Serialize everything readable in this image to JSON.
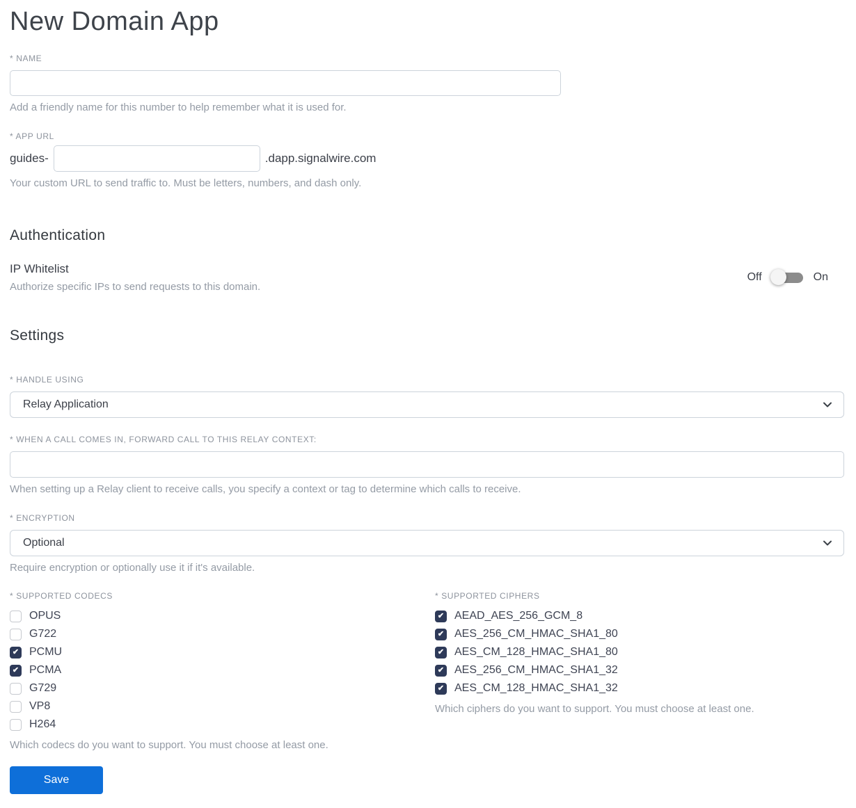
{
  "page": {
    "title": "New Domain App"
  },
  "fields": {
    "name": {
      "label": "* NAME",
      "value": "",
      "helper": "Add a friendly name for this number to help remember what it is used for."
    },
    "app_url": {
      "label": "* APP URL",
      "prefix": "guides-",
      "value": "",
      "suffix": ".dapp.signalwire.com",
      "helper": "Your custom URL to send traffic to. Must be letters, numbers, and dash only."
    }
  },
  "authentication": {
    "heading": "Authentication",
    "ip_whitelist": {
      "label": "IP Whitelist",
      "helper": "Authorize specific IPs to send requests to this domain.",
      "toggle": {
        "off_label": "Off",
        "on_label": "On",
        "state": "off"
      }
    }
  },
  "settings": {
    "heading": "Settings",
    "handle_using": {
      "label": "* HANDLE USING",
      "selected": "Relay Application"
    },
    "relay_context": {
      "label": "* WHEN A CALL COMES IN, FORWARD CALL TO THIS RELAY CONTEXT:",
      "value": "",
      "helper": "When setting up a Relay client to receive calls, you specify a context or tag to determine which calls to receive."
    },
    "encryption": {
      "label": "* ENCRYPTION",
      "selected": "Optional",
      "helper": "Require encryption or optionally use it if it's available."
    },
    "codecs": {
      "label": "* SUPPORTED CODECS",
      "helper": "Which codecs do you want to support. You must choose at least one.",
      "options": [
        {
          "label": "OPUS",
          "checked": false
        },
        {
          "label": "G722",
          "checked": false
        },
        {
          "label": "PCMU",
          "checked": true
        },
        {
          "label": "PCMA",
          "checked": true
        },
        {
          "label": "G729",
          "checked": false
        },
        {
          "label": "VP8",
          "checked": false
        },
        {
          "label": "H264",
          "checked": false
        }
      ]
    },
    "ciphers": {
      "label": "* SUPPORTED CIPHERS",
      "helper": "Which ciphers do you want to support. You must choose at least one.",
      "options": [
        {
          "label": "AEAD_AES_256_GCM_8",
          "checked": true
        },
        {
          "label": "AES_256_CM_HMAC_SHA1_80",
          "checked": true
        },
        {
          "label": "AES_CM_128_HMAC_SHA1_80",
          "checked": true
        },
        {
          "label": "AES_256_CM_HMAC_SHA1_32",
          "checked": true
        },
        {
          "label": "AES_CM_128_HMAC_SHA1_32",
          "checked": true
        }
      ]
    }
  },
  "actions": {
    "save_label": "Save"
  },
  "colors": {
    "accent_blue": "#0e6fd9",
    "checkbox_checked": "#2e3a59",
    "toggle_track": "#8c8c8c",
    "toggle_knob": "#f5f5f5"
  }
}
